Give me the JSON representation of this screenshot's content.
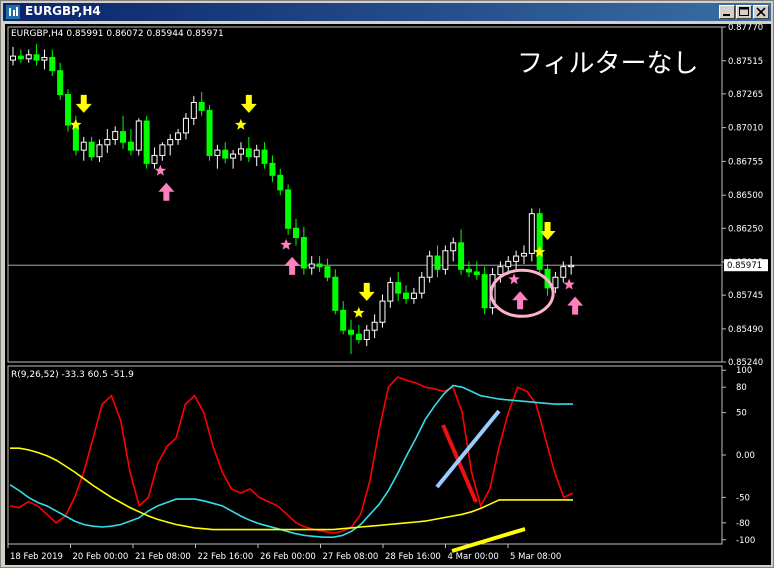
{
  "window": {
    "title": "EURGBP,H4"
  },
  "main_header": "EURGBP,H4  0.85991 0.86072 0.85944 0.85971",
  "indicator_header": "R(9,26,52) -33.3 60.5 -51.9",
  "overlay_text": "フィルターなし",
  "price_axis": {
    "labels": [
      "0.87770",
      "0.87515",
      "0.87265",
      "0.87010",
      "0.86755",
      "0.86500",
      "0.86250",
      "0.85995",
      "0.85745",
      "0.85490",
      "0.85240"
    ],
    "current": "0.85971"
  },
  "indicator_axis": {
    "labels": [
      "100",
      "80",
      "50",
      "0.00",
      "-50",
      "-80",
      "-100"
    ]
  },
  "time_axis": {
    "labels": [
      "18 Feb 2019",
      "20 Feb 00:00",
      "21 Feb 08:00",
      "22 Feb 16:00",
      "26 Feb 00:00",
      "27 Feb 08:00",
      "28 Feb 16:00",
      "4 Mar 00:00",
      "5 Mar 08:00"
    ]
  },
  "colors": {
    "bull": "#ffffff",
    "bear": "#00ff00",
    "signal_sell": "#ffff00",
    "signal_buy": "#ff7fbf",
    "line_red": "#ff0000",
    "line_cyan": "#33dde8",
    "line_yellow": "#ffff00"
  },
  "chart_data": [
    {
      "type": "candlestick",
      "symbol": "EURGBP",
      "timeframe": "H4",
      "ylim": [
        0.8524,
        0.8777
      ],
      "candles": [
        [
          0.8752,
          0.8762,
          0.8748,
          0.8755
        ],
        [
          0.8755,
          0.876,
          0.875,
          0.8753
        ],
        [
          0.8753,
          0.876,
          0.875,
          0.8756
        ],
        [
          0.8756,
          0.8764,
          0.8748,
          0.8752
        ],
        [
          0.8752,
          0.876,
          0.8745,
          0.8754
        ],
        [
          0.8754,
          0.876,
          0.874,
          0.8744
        ],
        [
          0.8744,
          0.875,
          0.8722,
          0.8726
        ],
        [
          0.8726,
          0.873,
          0.8698,
          0.8703
        ],
        [
          0.8703,
          0.871,
          0.868,
          0.8684
        ],
        [
          0.8684,
          0.8694,
          0.8676,
          0.869
        ],
        [
          0.869,
          0.8694,
          0.8676,
          0.8679
        ],
        [
          0.8679,
          0.8692,
          0.8675,
          0.8688
        ],
        [
          0.8688,
          0.87,
          0.8682,
          0.8692
        ],
        [
          0.8692,
          0.8702,
          0.8688,
          0.8698
        ],
        [
          0.8698,
          0.871,
          0.8685,
          0.869
        ],
        [
          0.869,
          0.87,
          0.868,
          0.8684
        ],
        [
          0.8684,
          0.8708,
          0.868,
          0.8706
        ],
        [
          0.8706,
          0.871,
          0.867,
          0.8674
        ],
        [
          0.8674,
          0.8686,
          0.867,
          0.868
        ],
        [
          0.868,
          0.869,
          0.8676,
          0.8688
        ],
        [
          0.8688,
          0.8696,
          0.868,
          0.8692
        ],
        [
          0.8692,
          0.87,
          0.8688,
          0.8697
        ],
        [
          0.8697,
          0.8712,
          0.8692,
          0.8708
        ],
        [
          0.8708,
          0.8725,
          0.8703,
          0.872
        ],
        [
          0.872,
          0.8728,
          0.871,
          0.8714
        ],
        [
          0.8714,
          0.8718,
          0.8676,
          0.868
        ],
        [
          0.868,
          0.8688,
          0.867,
          0.8684
        ],
        [
          0.8684,
          0.869,
          0.8674,
          0.8678
        ],
        [
          0.8678,
          0.8684,
          0.867,
          0.8681
        ],
        [
          0.8681,
          0.869,
          0.8676,
          0.8685
        ],
        [
          0.8685,
          0.8694,
          0.8675,
          0.8679
        ],
        [
          0.8679,
          0.8688,
          0.8672,
          0.8684
        ],
        [
          0.8684,
          0.869,
          0.867,
          0.8674
        ],
        [
          0.8674,
          0.868,
          0.866,
          0.8665
        ],
        [
          0.8665,
          0.867,
          0.865,
          0.8654
        ],
        [
          0.8654,
          0.8658,
          0.862,
          0.8625
        ],
        [
          0.8625,
          0.8632,
          0.8612,
          0.8618
        ],
        [
          0.8618,
          0.8626,
          0.859,
          0.8595
        ],
        [
          0.8595,
          0.8604,
          0.859,
          0.8598
        ],
        [
          0.8598,
          0.8604,
          0.8592,
          0.8596
        ],
        [
          0.8596,
          0.8602,
          0.8585,
          0.8588
        ],
        [
          0.8588,
          0.8594,
          0.856,
          0.8563
        ],
        [
          0.8563,
          0.857,
          0.8545,
          0.8548
        ],
        [
          0.8548,
          0.8556,
          0.853,
          0.8545
        ],
        [
          0.8545,
          0.8552,
          0.8538,
          0.8541
        ],
        [
          0.8541,
          0.8552,
          0.8536,
          0.8548
        ],
        [
          0.8548,
          0.856,
          0.8542,
          0.8554
        ],
        [
          0.8554,
          0.8575,
          0.855,
          0.857
        ],
        [
          0.857,
          0.8588,
          0.8565,
          0.8584
        ],
        [
          0.8584,
          0.8592,
          0.857,
          0.8576
        ],
        [
          0.8576,
          0.8582,
          0.8568,
          0.8572
        ],
        [
          0.8572,
          0.858,
          0.8568,
          0.8576
        ],
        [
          0.8576,
          0.8592,
          0.8572,
          0.8588
        ],
        [
          0.8588,
          0.8608,
          0.8584,
          0.8604
        ],
        [
          0.8604,
          0.8612,
          0.8588,
          0.8594
        ],
        [
          0.8594,
          0.8612,
          0.859,
          0.8608
        ],
        [
          0.8608,
          0.8618,
          0.86,
          0.8614
        ],
        [
          0.8614,
          0.8624,
          0.859,
          0.8594
        ],
        [
          0.8594,
          0.86,
          0.8588,
          0.8592
        ],
        [
          0.8592,
          0.86,
          0.8586,
          0.859
        ],
        [
          0.859,
          0.8596,
          0.856,
          0.8565
        ],
        [
          0.8565,
          0.8595,
          0.856,
          0.859
        ],
        [
          0.859,
          0.86,
          0.8584,
          0.8596
        ],
        [
          0.8596,
          0.8604,
          0.859,
          0.86
        ],
        [
          0.86,
          0.8608,
          0.8594,
          0.8604
        ],
        [
          0.8604,
          0.8612,
          0.8598,
          0.8606
        ],
        [
          0.8606,
          0.864,
          0.86,
          0.8636
        ],
        [
          0.8636,
          0.864,
          0.859,
          0.8594
        ],
        [
          0.8594,
          0.8598,
          0.8574,
          0.858
        ],
        [
          0.858,
          0.8592,
          0.8576,
          0.8588
        ],
        [
          0.8588,
          0.86,
          0.8584,
          0.8596
        ],
        [
          0.8596,
          0.8604,
          0.859,
          0.8597
        ]
      ]
    },
    {
      "type": "line",
      "title": "R(9,26,52)",
      "ylim": [
        -105,
        105
      ],
      "series": [
        {
          "color": "#ff0000",
          "values": [
            -60,
            -62,
            -55,
            -60,
            -70,
            -80,
            -72,
            -50,
            -20,
            20,
            60,
            70,
            40,
            -20,
            -60,
            -50,
            -10,
            10,
            20,
            60,
            70,
            50,
            10,
            -20,
            -40,
            -45,
            -40,
            -50,
            -55,
            -60,
            -70,
            -80,
            -85,
            -88,
            -90,
            -92,
            -90,
            -85,
            -70,
            -30,
            30,
            80,
            92,
            88,
            85,
            80,
            78,
            75,
            80,
            50,
            -20,
            -60,
            -40,
            10,
            50,
            80,
            75,
            60,
            20,
            -20,
            -50,
            -45
          ]
        },
        {
          "color": "#33dde8",
          "values": [
            -35,
            -42,
            -50,
            -56,
            -60,
            -66,
            -72,
            -78,
            -82,
            -84,
            -85,
            -84,
            -82,
            -78,
            -74,
            -66,
            -60,
            -56,
            -52,
            -52,
            -52,
            -54,
            -57,
            -60,
            -66,
            -72,
            -77,
            -81,
            -84,
            -87,
            -90,
            -93,
            -95,
            -96,
            -97,
            -97,
            -95,
            -90,
            -82,
            -70,
            -58,
            -42,
            -22,
            0,
            20,
            42,
            58,
            72,
            82,
            80,
            75,
            70,
            68,
            66,
            65,
            64,
            63,
            62,
            61,
            60,
            60,
            60
          ]
        },
        {
          "color": "#ffff00",
          "values": [
            8,
            8,
            6,
            3,
            -1,
            -6,
            -13,
            -20,
            -28,
            -36,
            -43,
            -50,
            -56,
            -62,
            -67,
            -72,
            -76,
            -79,
            -82,
            -84,
            -86,
            -87,
            -88,
            -88,
            -88,
            -88,
            -88,
            -88,
            -88,
            -88,
            -88,
            -88,
            -88,
            -88,
            -88,
            -88,
            -87,
            -86,
            -85,
            -84,
            -83,
            -82,
            -81,
            -80,
            -79,
            -78,
            -76,
            -74,
            -72,
            -70,
            -67,
            -63,
            -58,
            -53,
            -53,
            -53,
            -53,
            -53,
            -53,
            -53,
            -53,
            -53
          ]
        }
      ]
    }
  ],
  "signals": {
    "sell_arrows": [
      9,
      30,
      45,
      68
    ],
    "buy_arrows": [
      19,
      35,
      64,
      71
    ]
  }
}
